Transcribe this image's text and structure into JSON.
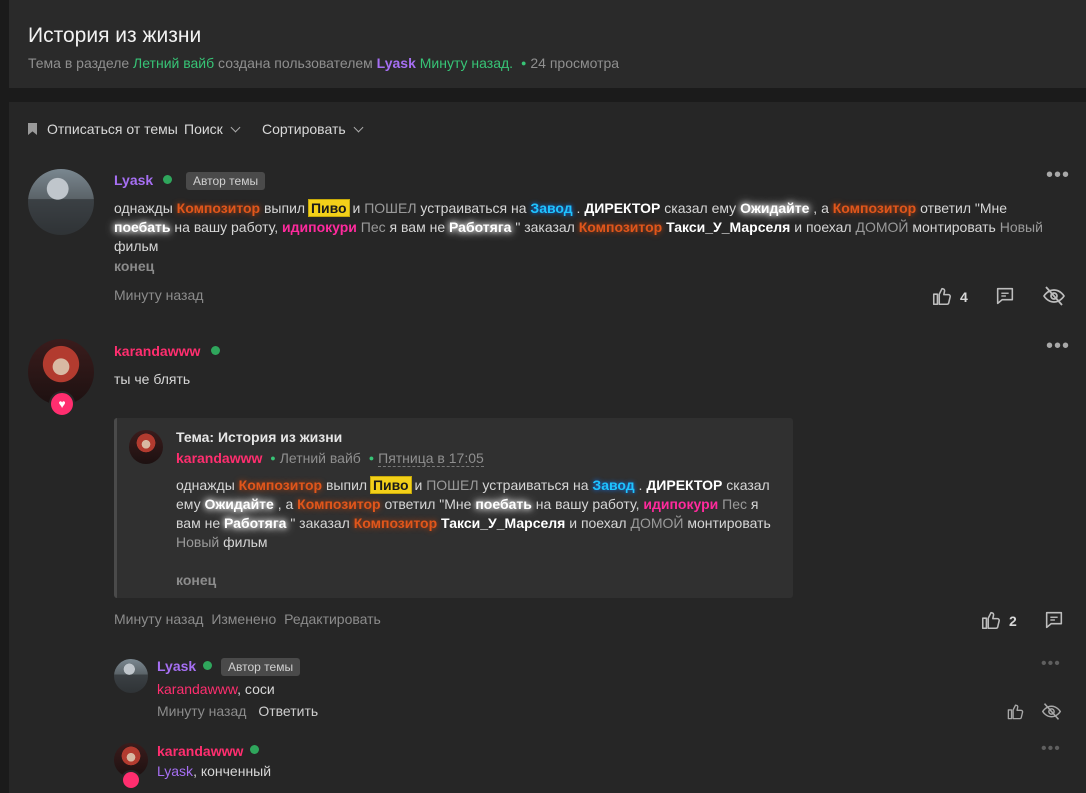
{
  "thread": {
    "title": "История из жизни",
    "meta_prefix": "Тема в разделе",
    "section": "Летний вайб",
    "meta_by": "создана пользователем",
    "author": "Lyask",
    "created": "Минуту назад.",
    "views": "24 просмотра"
  },
  "toolbar": {
    "unsubscribe": "Отписаться от темы",
    "search": "Поиск",
    "sort": "Сортировать"
  },
  "posts": [
    {
      "author": "Lyask",
      "badge": "Автор темы",
      "parts": [
        "однажды ",
        "Композитор",
        " выпил ",
        "Пиво",
        " и ",
        "ПОШЕЛ",
        " устраиваться на ",
        "Завод",
        " . ",
        "ДИРЕКТОР",
        " сказал ему ",
        "Ожидайте",
        " , а ",
        "Композитор",
        " ответил \"Мне ",
        "поебать",
        " на вашу работу, ",
        "идипокури",
        " ",
        "Пес",
        " я вам не ",
        "Работяга",
        " \" заказал ",
        "Композитор",
        " ",
        "Такси_У_Марселя",
        " и поехал ",
        "ДОМОЙ",
        " монтировать ",
        "Новый",
        " фильм"
      ],
      "tail": "конец",
      "time": "Минуту назад",
      "likes": "4"
    },
    {
      "author": "karandawww",
      "text": "ты че блять",
      "quote": {
        "label": "Тема: История из жизни",
        "author": "karandawww",
        "section": "Летний вайб",
        "time": "Пятница в 17:05",
        "tail": "конец"
      },
      "time": "Минуту назад",
      "edited": "Изменено",
      "edit": "Редактировать",
      "likes": "2"
    }
  ],
  "replies": [
    {
      "author": "Lyask",
      "badge": "Автор темы",
      "mention": "karandawww",
      "text": ", соси",
      "time": "Минуту назад",
      "reply": "Ответить"
    },
    {
      "author": "karandawww",
      "mention": "Lyask",
      "text": ", конченный"
    }
  ],
  "colors": {
    "accent_green": "#37c476",
    "author_purple": "#a66ff3",
    "author_pink": "#ff2e6f"
  }
}
